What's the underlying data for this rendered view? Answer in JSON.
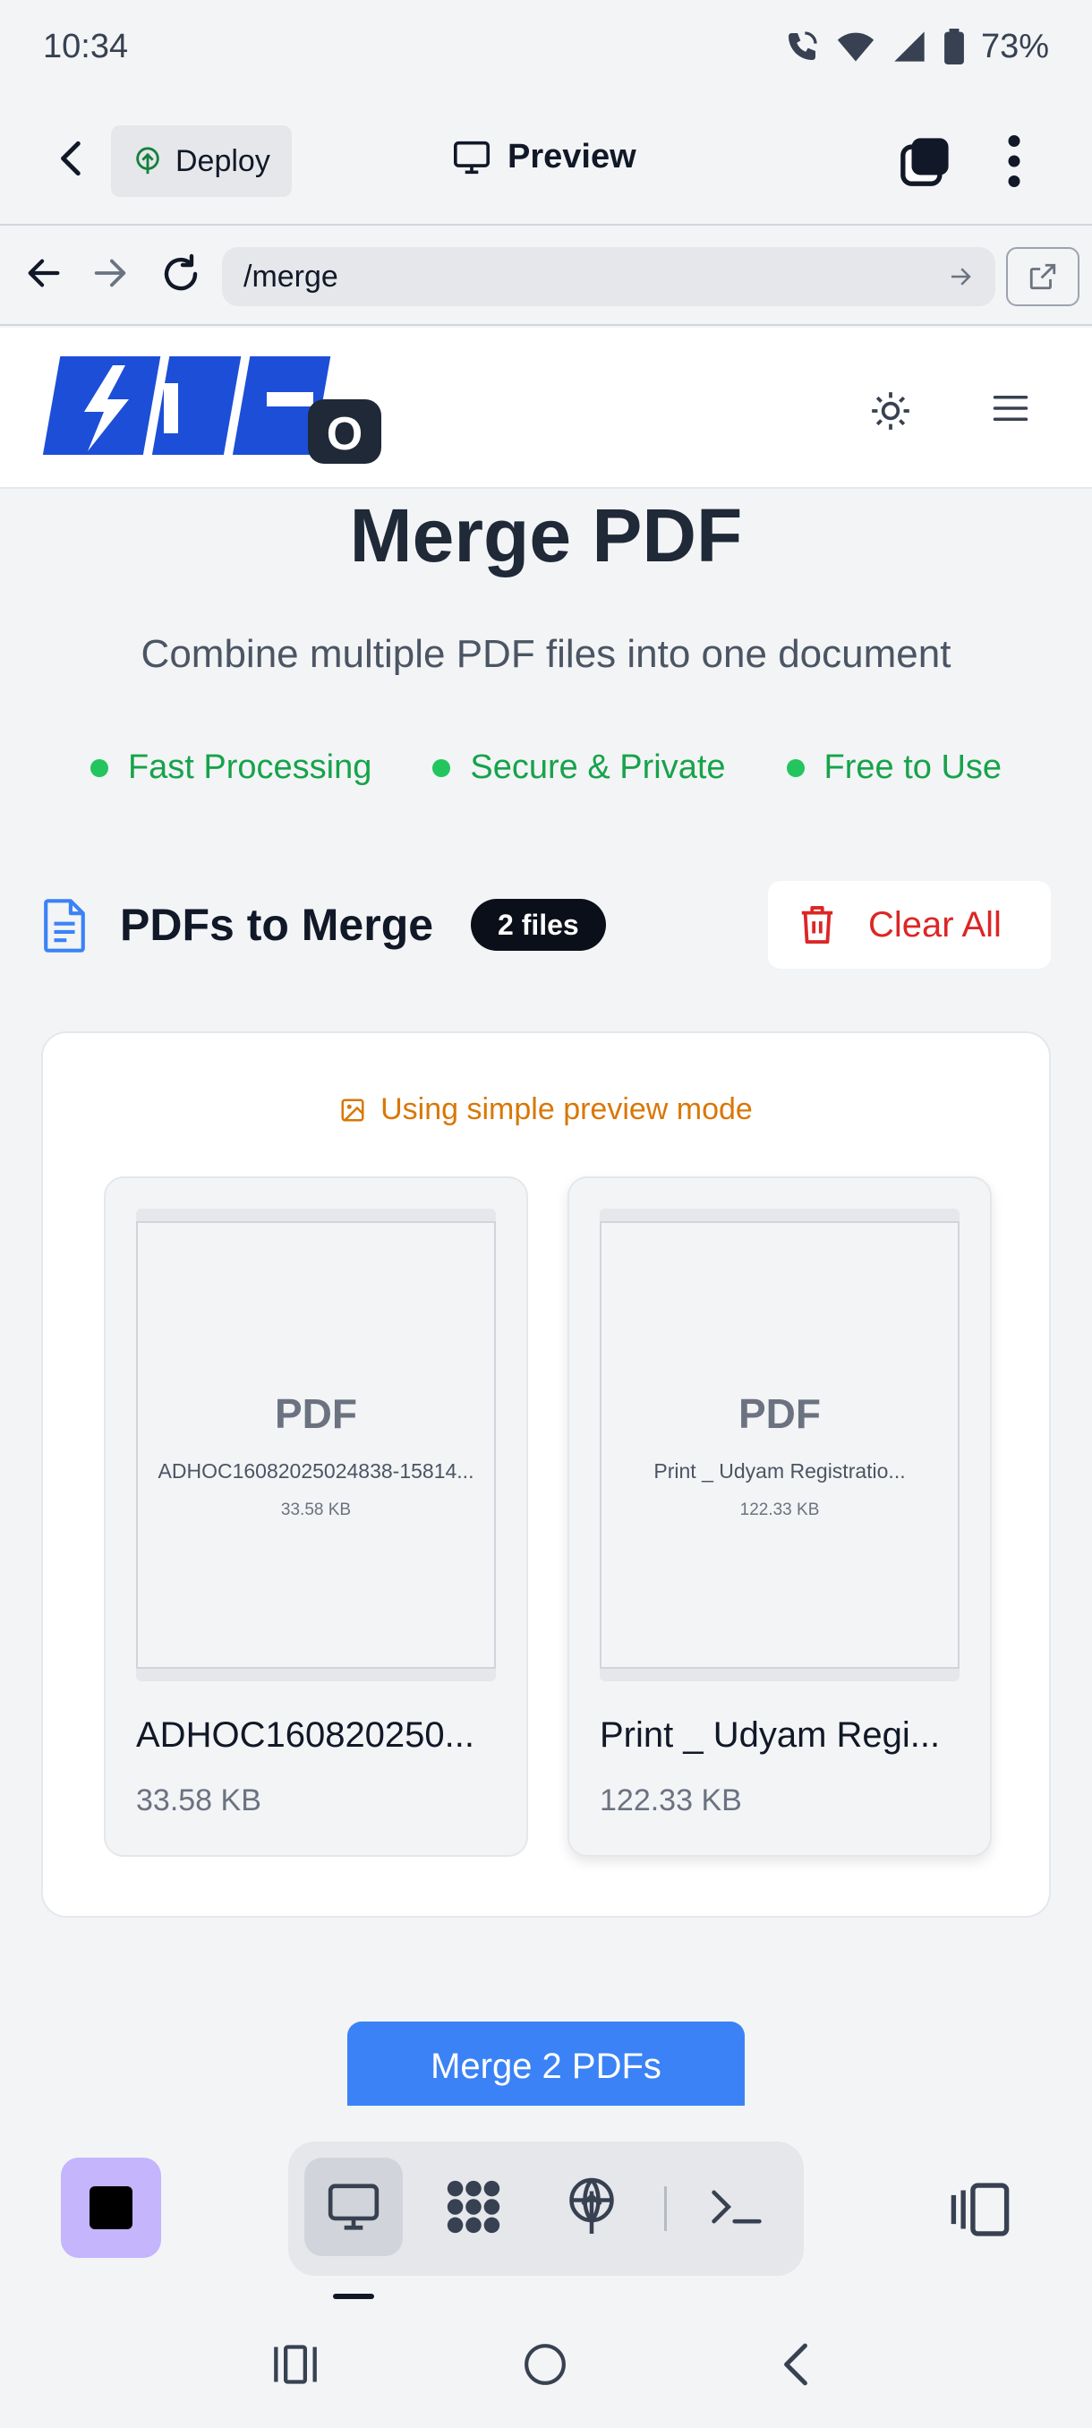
{
  "status": {
    "time": "10:34",
    "battery": "73%"
  },
  "appbar": {
    "deploy_label": "Deploy",
    "preview_label": "Preview"
  },
  "urlbar": {
    "url": "/merge"
  },
  "site": {
    "logo_text": "PDF",
    "logo_badge": "O"
  },
  "main": {
    "title": "Merge PDF",
    "subtitle": "Combine multiple PDF files into one document",
    "features": [
      "Fast Processing",
      "Secure & Private",
      "Free to Use"
    ],
    "section_title": "PDFs to Merge",
    "file_count": "2 files",
    "clear_label": "Clear All",
    "preview_note": "Using simple preview mode",
    "files": [
      {
        "thumb_label": "PDF",
        "thumb_name": "ADHOC16082025024838-15814...",
        "thumb_size": "33.58 KB",
        "name": "ADHOC160820250...",
        "size": "33.58 KB"
      },
      {
        "thumb_label": "PDF",
        "thumb_name": "Print _ Udyam Registratio...",
        "thumb_size": "122.33 KB",
        "name": "Print _ Udyam Regi...",
        "size": "122.33 KB"
      }
    ],
    "merge_label": "Merge 2 PDFs"
  },
  "colors": {
    "accent": "#3b82f6",
    "danger": "#dc2626",
    "success": "#22c55e",
    "warning": "#d97706",
    "logo_blue": "#1d4ed8"
  },
  "icons": [
    "back-arrow-icon",
    "deploy-icon",
    "monitor-icon",
    "tabs-icon",
    "more-vert-icon",
    "refresh-icon",
    "external-link-icon",
    "sun-icon",
    "menu-icon",
    "document-icon",
    "trash-icon",
    "image-icon",
    "stop-icon",
    "apps-icon",
    "network-icon",
    "terminal-icon",
    "device-icon"
  ]
}
